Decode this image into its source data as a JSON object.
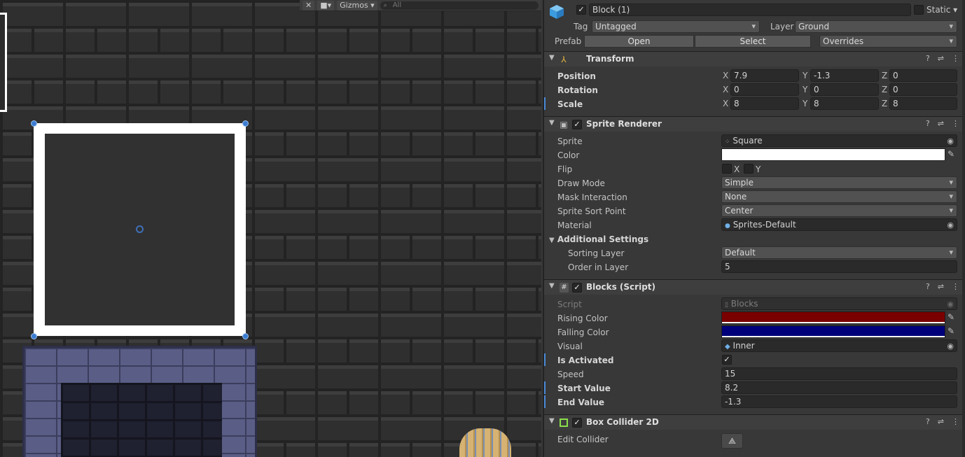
{
  "scene": {
    "toolbar": {
      "tools_icon": "tools-icon",
      "camera_icon": "camera-icon",
      "gizmos_label": "Gizmos",
      "search_placeholder": "All"
    }
  },
  "inspector": {
    "header": {
      "object_name": "Block (1)",
      "static_label": "Static",
      "tag_label": "Tag",
      "tag_value": "Untagged",
      "layer_label": "Layer",
      "layer_value": "Ground",
      "prefab_label": "Prefab",
      "open_label": "Open",
      "select_label": "Select",
      "overrides_label": "Overrides"
    },
    "transform": {
      "title": "Transform",
      "position_label": "Position",
      "rotation_label": "Rotation",
      "scale_label": "Scale",
      "position": {
        "x": "7.9",
        "y": "-1.3",
        "z": "0"
      },
      "rotation": {
        "x": "0",
        "y": "0",
        "z": "0"
      },
      "scale": {
        "x": "8",
        "y": "8",
        "z": "8"
      },
      "axis_x": "X",
      "axis_y": "Y",
      "axis_z": "Z"
    },
    "sprite_renderer": {
      "title": "Sprite Renderer",
      "sprite_label": "Sprite",
      "sprite_value": "Square",
      "color_label": "Color",
      "color_value": "#ffffff",
      "flip_label": "Flip",
      "flip_x": "X",
      "flip_y": "Y",
      "draw_mode_label": "Draw Mode",
      "draw_mode_value": "Simple",
      "mask_label": "Mask Interaction",
      "mask_value": "None",
      "sort_point_label": "Sprite Sort Point",
      "sort_point_value": "Center",
      "material_label": "Material",
      "material_value": "Sprites-Default",
      "additional_label": "Additional Settings",
      "sorting_layer_label": "Sorting Layer",
      "sorting_layer_value": "Default",
      "order_label": "Order in Layer",
      "order_value": "5"
    },
    "blocks_script": {
      "title": "Blocks (Script)",
      "script_label": "Script",
      "script_value": "Blocks",
      "rising_label": "Rising Color",
      "rising_color": "#7a0000",
      "falling_label": "Falling Color",
      "falling_color": "#00007a",
      "visual_label": "Visual",
      "visual_value": "Inner",
      "activated_label": "Is Activated",
      "speed_label": "Speed",
      "speed_value": "15",
      "start_label": "Start Value",
      "start_value": "8.2",
      "end_label": "End Value",
      "end_value": "-1.3"
    },
    "box_collider": {
      "title": "Box Collider 2D",
      "edit_label": "Edit Collider"
    }
  }
}
